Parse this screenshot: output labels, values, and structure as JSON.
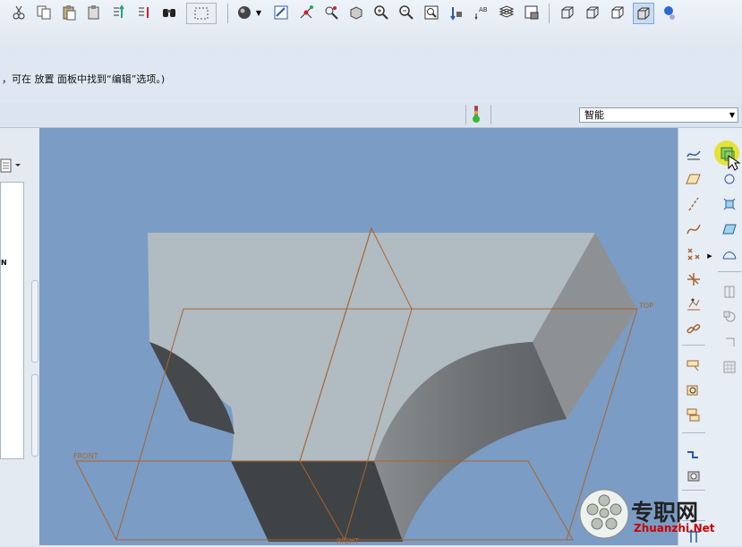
{
  "message": "，可在 放置 面板中找到“编辑”选项。)",
  "filter": {
    "value": "智能"
  },
  "datums": {
    "top": "TOP",
    "front": "FRONT",
    "right": "RIGHT"
  },
  "watermark": {
    "text": "专职网",
    "site": "Zhuanzhi.Net"
  },
  "toolbar_icons": [
    "cut-icon",
    "copy-icon",
    "paste-icon",
    "paste-special-icon",
    "regenerate-icon",
    "regen-manager-icon",
    "find-icon",
    "select-box-icon",
    "shading-icon",
    "repaint-icon",
    "spin-center-icon",
    "orient-icon",
    "saved-views-icon",
    "zoom-in-icon",
    "zoom-out-icon",
    "refit-icon",
    "datum-display-icon",
    "annotation-icon",
    "layers-icon",
    "model-tree-icon",
    "wireframe-icon",
    "hidden-line-icon",
    "no-hidden-icon",
    "shaded-icon",
    "appearance-icon"
  ],
  "right_icons": [
    "sketch-icon",
    "plane-icon",
    "axis-icon",
    "curve-icon",
    "point-icon",
    "csys-icon",
    "analysis-icon",
    "chain-icon",
    "extrude-icon",
    "revolve-icon",
    "sweep-icon",
    "blend-icon",
    "hole-icon",
    "round-icon",
    "chamfer-icon",
    "shell-icon",
    "rib-icon",
    "draft-icon",
    "pattern-icon",
    "mirror-icon",
    "merge-icon",
    "trim-icon"
  ]
}
